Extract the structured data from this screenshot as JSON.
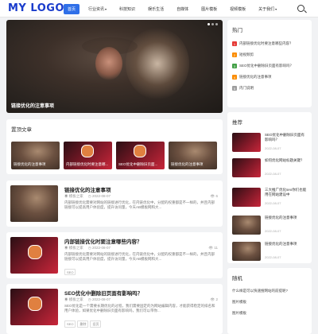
{
  "header": {
    "logo": "MY LOGO",
    "nav": [
      {
        "label": "首页",
        "active": true,
        "has_caret": false
      },
      {
        "label": "行业资讯",
        "active": false,
        "has_caret": true
      },
      {
        "label": "科技知识",
        "active": false,
        "has_caret": false
      },
      {
        "label": "娱乐生活",
        "active": false,
        "has_caret": false
      },
      {
        "label": "自媒体",
        "active": false,
        "has_caret": false
      },
      {
        "label": "图片模板",
        "active": false,
        "has_caret": false
      },
      {
        "label": "视频模板",
        "active": false,
        "has_caret": false
      },
      {
        "label": "关于我们",
        "active": false,
        "has_caret": true
      }
    ],
    "search_icon": "search-icon"
  },
  "hero": {
    "caption": "链接优化的注意事项"
  },
  "recommended": {
    "title": "置顶文章",
    "items": [
      {
        "label": "链接优化的注意事项",
        "style": "girl"
      },
      {
        "label": "内部链接优化时要注意哪...",
        "style": "red"
      },
      {
        "label": "SEO优化中删除旧页面...",
        "style": "red"
      },
      {
        "label": "链接优化的注意事项",
        "style": "girl"
      }
    ]
  },
  "posts": [
    {
      "title": "链接优化的注意事项",
      "author": "模板之家",
      "date": "2022-08-07",
      "views": "6",
      "excerpt": "内部链接优化需要对网站的链接进行优化，在内链优化中，分配的权重都是不一样的，并且内部链接可以提高用户体验度，提升访问量，今天AB模板网和大...",
      "tags": [],
      "thumb": "girl"
    },
    {
      "title": "内部链接优化时要注意哪些内容？",
      "author": "模板之家",
      "date": "2022-08-07",
      "views": "11",
      "excerpt": "内部链接优化需要对网站的链接进行优化，在内链优化中，分配的权重都是不一样的，并且内部链接可以提高用户体验度，提升访问量，今天AB模板网和大...",
      "tags": [
        "SEO"
      ],
      "thumb": "red"
    },
    {
      "title": "SEO优化中删除旧页面有影响吗？",
      "author": "模板之家",
      "date": "2022-08-07",
      "views": "2",
      "excerpt": "SEO优化是一个需要长期优化的过程，我们需要固定的为网站编辑内容，才能获得稳定的排名和用户体验，如果优化中删除旧页面有影响吗，我们可以带你...",
      "tags": [
        "SEO",
        "删除",
        "旧页"
      ],
      "thumb": "red"
    }
  ],
  "sidebar": {
    "hot_title": "热门",
    "hot_items": [
      {
        "num": "1",
        "color": "#e53935",
        "label": "内部链接优化时要注意哪些内容？"
      },
      {
        "num": "2",
        "color": "#fb8c00",
        "label": "短视频剪"
      },
      {
        "num": "3",
        "color": "#43a047",
        "label": "SEO优化中删除旧页面有影响吗？"
      },
      {
        "num": "4",
        "color": "#fb8c00",
        "label": "链接优化的注意事项"
      },
      {
        "num": "5",
        "color": "#9e9e9e",
        "label": "内门说明"
      }
    ],
    "rec_title": "推荐",
    "rec_items": [
      {
        "title": "SEO优化中删除旧页面有影响吗？",
        "date": "2022-08-07",
        "thumb": "red"
      },
      {
        "title": "如何优化网站标题关键？",
        "date": "2022-08-07",
        "thumb": "red"
      },
      {
        "title": "三大推广优化seo你们也能用在网站建设中",
        "date": "2022-08-07",
        "thumb": "red"
      },
      {
        "title": "链接优化的注意事项",
        "date": "2022-08-07",
        "thumb": "girl"
      },
      {
        "title": "链接优化的注意事项",
        "date": "2022-08-07",
        "thumb": "girl"
      }
    ],
    "random_title": "随机",
    "random_items": [
      "什么样是可以快速搜网站的前提呢?",
      "图片模板",
      "图片模板"
    ]
  }
}
